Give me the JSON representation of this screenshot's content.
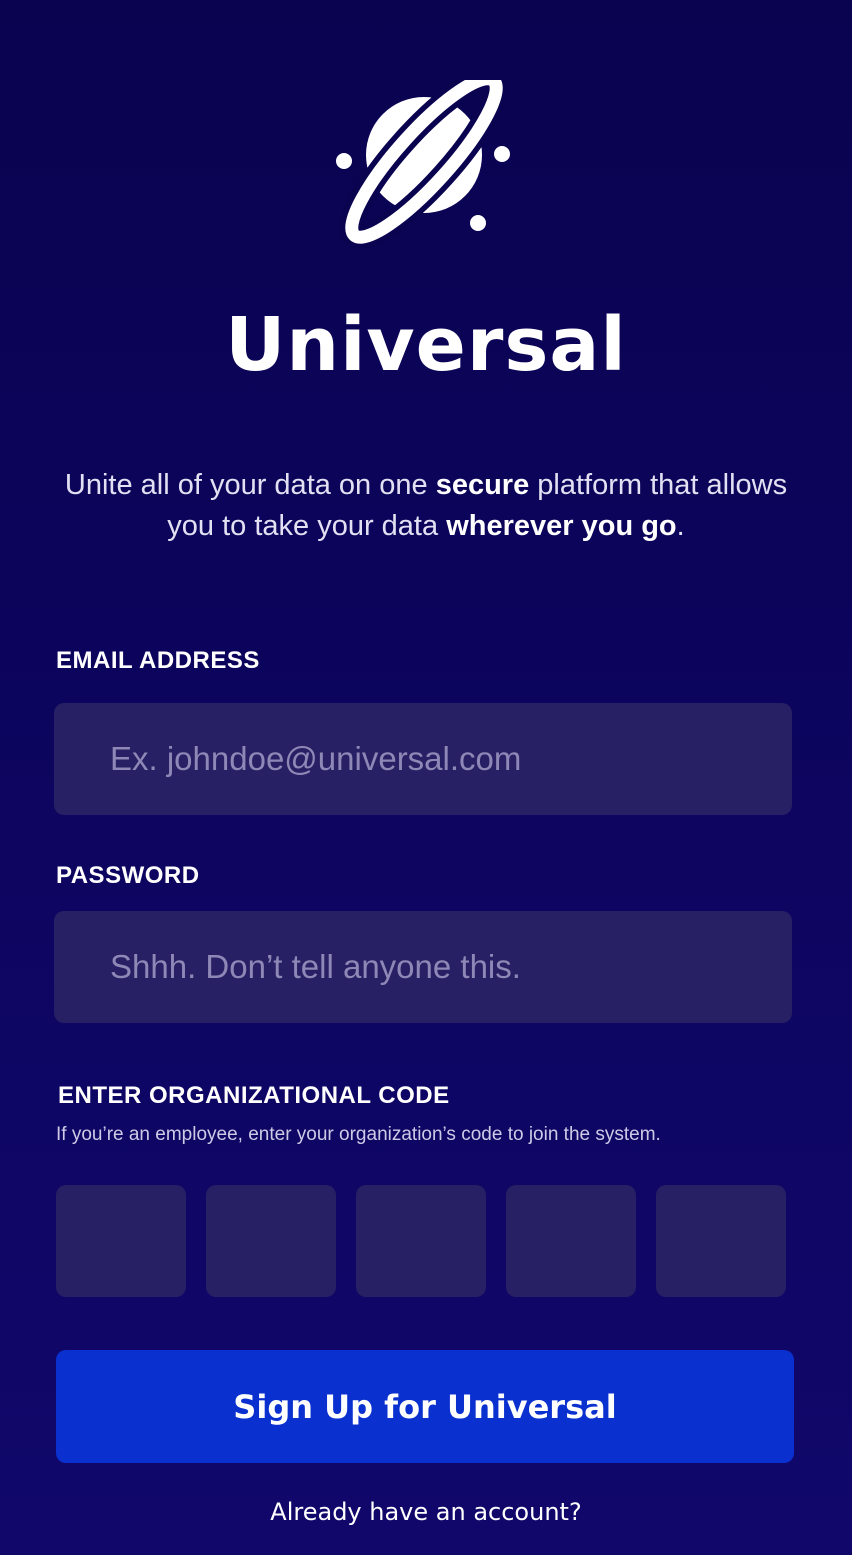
{
  "brand": {
    "name": "Universal",
    "logo_icon": "planet-icon"
  },
  "tagline": {
    "part1": "Unite all of your data on one ",
    "bold1": "secure",
    "part2": " platform that allows you to take your data ",
    "bold2": "wherever you go",
    "part3": "."
  },
  "form": {
    "email": {
      "label": "EMAIL ADDRESS",
      "value": "",
      "placeholder": "Ex. johndoe@universal.com"
    },
    "password": {
      "label": "PASSWORD",
      "value": "",
      "placeholder": "Shhh. Don’t tell anyone this."
    },
    "org_code": {
      "label": "ENTER ORGANIZATIONAL CODE",
      "hint": "If you’re an employee, enter your organization’s code to join the system.",
      "digits": [
        "",
        "",
        "",
        "",
        ""
      ]
    }
  },
  "actions": {
    "signup_label": "Sign Up for Universal",
    "signin_label": "Already have an account?"
  },
  "colors": {
    "background": "#0a0350",
    "input_fill": "#272064",
    "button_fill": "#0a31cf",
    "text": "#ffffff"
  }
}
